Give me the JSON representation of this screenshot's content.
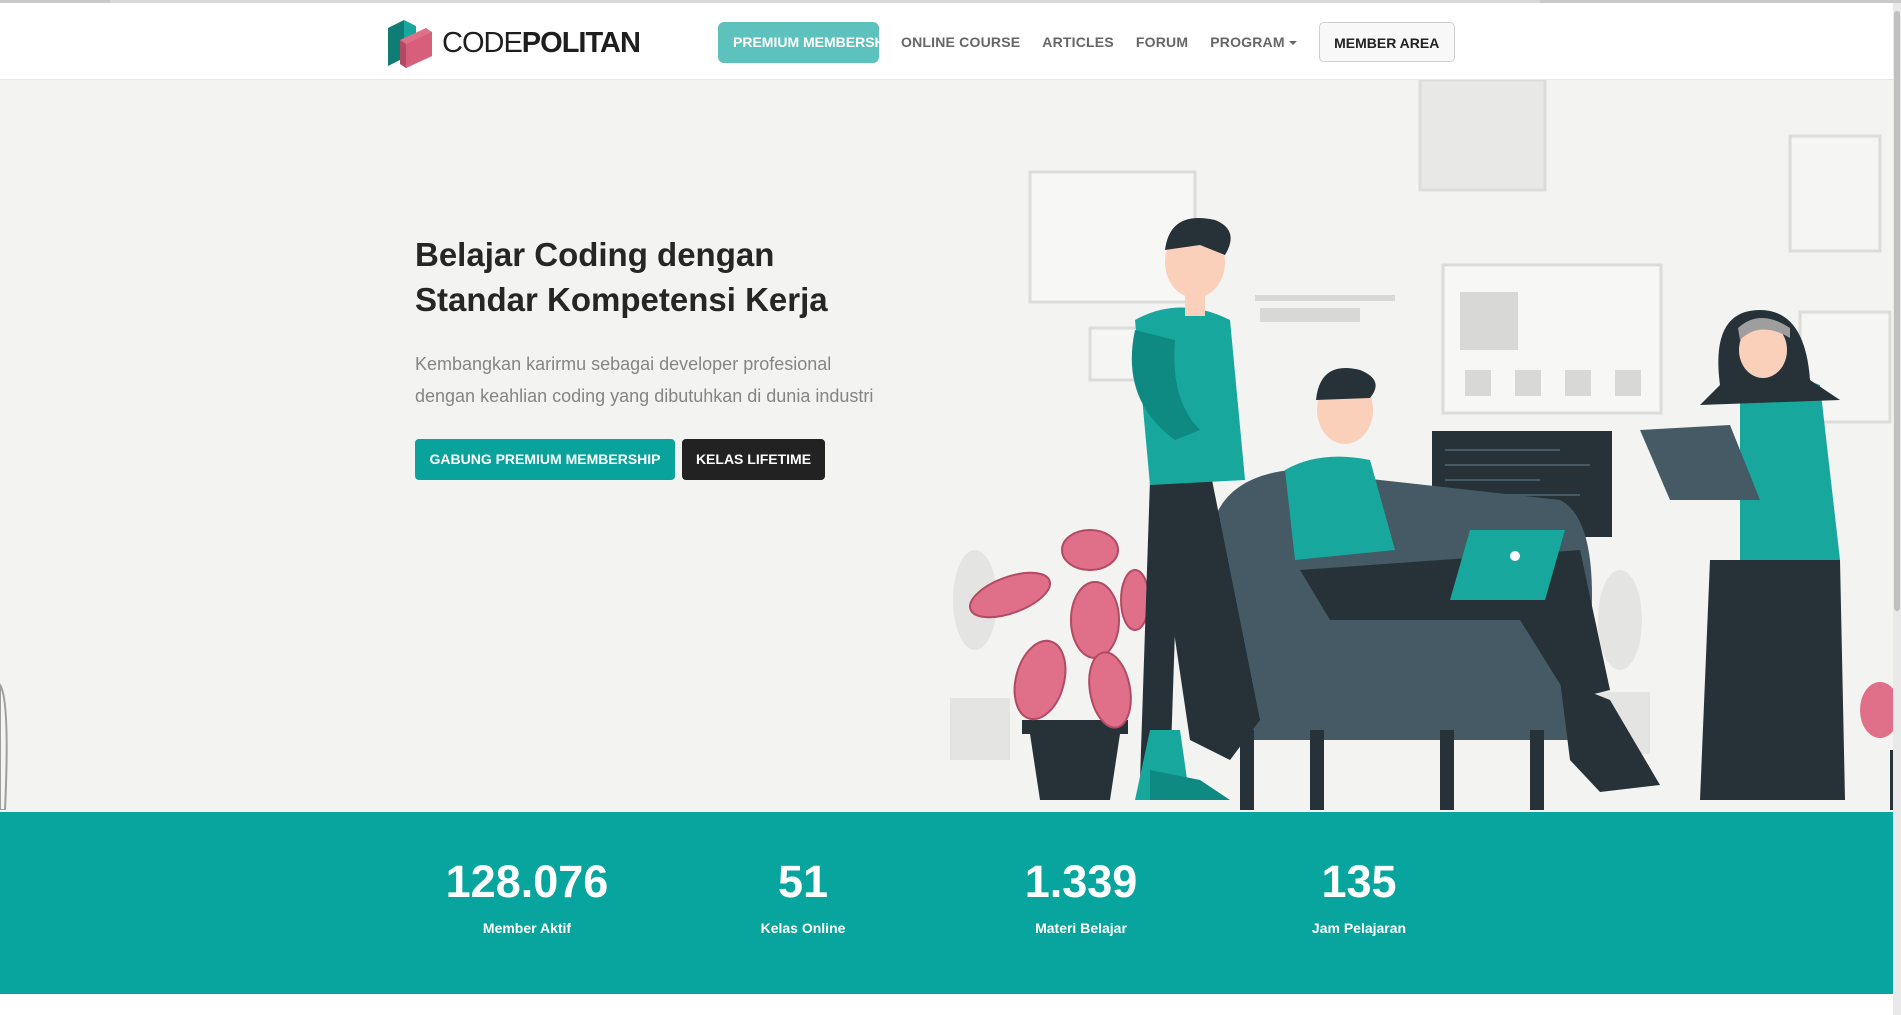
{
  "brand": {
    "name_prefix": "CODE",
    "name_suffix": "POLITAN",
    "colors": {
      "teal": "#09a39c",
      "pink": "#e0708a",
      "dark": "#222222",
      "light_teal": "#5dc2be"
    }
  },
  "nav": {
    "premium": "PREMIUM MEMBERSHIP",
    "online_course": "ONLINE COURSE",
    "articles": "ARTICLES",
    "forum": "FORUM",
    "program": "PROGRAM",
    "member_area": "MEMBER AREA"
  },
  "hero": {
    "title_line1": "Belajar Coding dengan",
    "title_line2": "Standar Kompetensi Kerja",
    "subtitle_line1": "Kembangkan karirmu sebagai developer profesional",
    "subtitle_line2": "dengan keahlian coding yang dibutuhkan di dunia industri",
    "cta_primary": "GABUNG PREMIUM MEMBERSHIP",
    "cta_secondary": "KELAS LIFETIME"
  },
  "stats": [
    {
      "value": "128.076",
      "label": "Member Aktif"
    },
    {
      "value": "51",
      "label": "Kelas Online"
    },
    {
      "value": "1.339",
      "label": "Materi Belajar"
    },
    {
      "value": "135",
      "label": "Jam Pelajaran"
    }
  ]
}
